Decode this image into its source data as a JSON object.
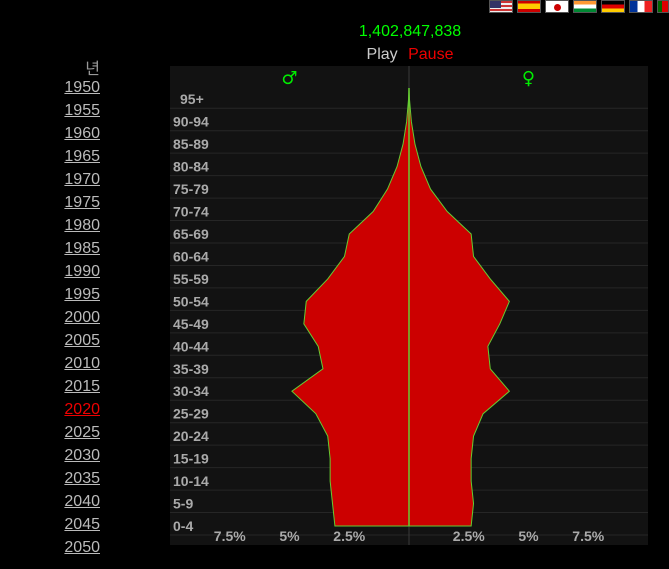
{
  "flags": [
    {
      "name": "flag-us-icon",
      "cls": "flag-us"
    },
    {
      "name": "flag-es-icon",
      "cls": "flag-es"
    },
    {
      "name": "flag-jp-icon",
      "cls": "flag-jp"
    },
    {
      "name": "flag-in-icon",
      "cls": "flag-in"
    },
    {
      "name": "flag-de-icon",
      "cls": "flag-de"
    },
    {
      "name": "flag-fr-icon",
      "cls": "flag-fr"
    },
    {
      "name": "flag-pt-icon",
      "cls": "flag-pt"
    }
  ],
  "population": "1,402,847,838",
  "controls": {
    "play": "Play",
    "pause": "Pause"
  },
  "year_header": "년",
  "years": [
    "1950",
    "1955",
    "1960",
    "1965",
    "1970",
    "1975",
    "1980",
    "1985",
    "1990",
    "1995",
    "2000",
    "2005",
    "2010",
    "2015",
    "2020",
    "2025",
    "2030",
    "2035",
    "2040",
    "2045",
    "2050"
  ],
  "selected_year": "2020",
  "colors": {
    "fill": "#cc0000",
    "outline": "#66cc33",
    "green": "#00ee00",
    "plot_bg": "#121212",
    "axis_text": "#aaaaaa"
  },
  "chart_data": {
    "type": "area",
    "orientation": "population-pyramid",
    "male_symbol": "♂",
    "female_symbol": "♀",
    "age_groups": [
      "0-4",
      "5-9",
      "10-14",
      "15-19",
      "20-24",
      "25-29",
      "30-34",
      "35-39",
      "40-44",
      "45-49",
      "50-54",
      "55-59",
      "60-64",
      "65-69",
      "70-74",
      "75-79",
      "80-84",
      "85-89",
      "90-94",
      "95+"
    ],
    "series": [
      {
        "name": "♂",
        "values": [
          3.1,
          3.2,
          3.3,
          3.3,
          3.4,
          3.9,
          4.9,
          3.6,
          3.8,
          4.4,
          4.3,
          3.4,
          2.7,
          2.5,
          1.5,
          0.9,
          0.5,
          0.25,
          0.1,
          0.02
        ]
      },
      {
        "name": "♀",
        "values": [
          2.6,
          2.7,
          2.6,
          2.6,
          2.7,
          3.1,
          4.2,
          3.4,
          3.3,
          3.8,
          4.2,
          3.4,
          2.7,
          2.6,
          1.6,
          0.9,
          0.5,
          0.25,
          0.1,
          0.02
        ]
      }
    ],
    "xlim": [
      -10,
      10
    ],
    "x_ticks": [
      {
        "value": -7.5,
        "label": "7.5%"
      },
      {
        "value": -5,
        "label": "5%"
      },
      {
        "value": -2.5,
        "label": "2.5%"
      },
      {
        "value": 2.5,
        "label": "2.5%"
      },
      {
        "value": 5,
        "label": "5%"
      },
      {
        "value": 7.5,
        "label": "7.5%"
      }
    ],
    "grid": true
  }
}
